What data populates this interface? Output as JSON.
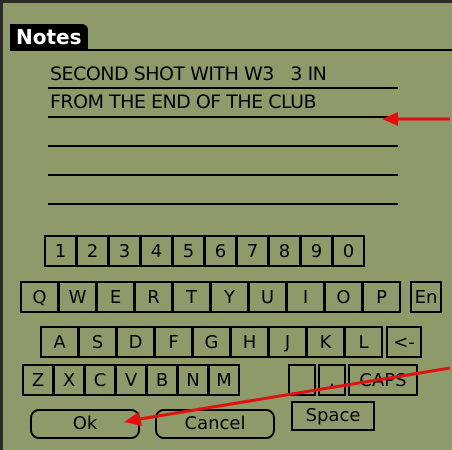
{
  "title": "Notes",
  "note_lines": [
    "SECOND SHOT WITH W3   3 IN",
    "FROM THE END OF THE CLUB",
    "",
    "",
    ""
  ],
  "keyboard": {
    "row1": [
      "1",
      "2",
      "3",
      "4",
      "5",
      "6",
      "7",
      "8",
      "9",
      "0"
    ],
    "row2": [
      "Q",
      "W",
      "E",
      "R",
      "T",
      "Y",
      "U",
      "I",
      "O",
      "P"
    ],
    "row2_extra": "En",
    "row3": [
      "A",
      "S",
      "D",
      "F",
      "G",
      "H",
      "J",
      "K",
      "L"
    ],
    "row3_extra": "<-",
    "row4": [
      "Z",
      "X",
      "C",
      "V",
      "B",
      "N",
      "M"
    ],
    "row4_blank": "",
    "row4_period": ".",
    "row4_caps": "CAPS"
  },
  "buttons": {
    "ok": "Ok",
    "cancel": "Cancel",
    "space": "Space"
  },
  "colors": {
    "background": "#8f9a6b",
    "annotation_arrow": "#e01010"
  }
}
